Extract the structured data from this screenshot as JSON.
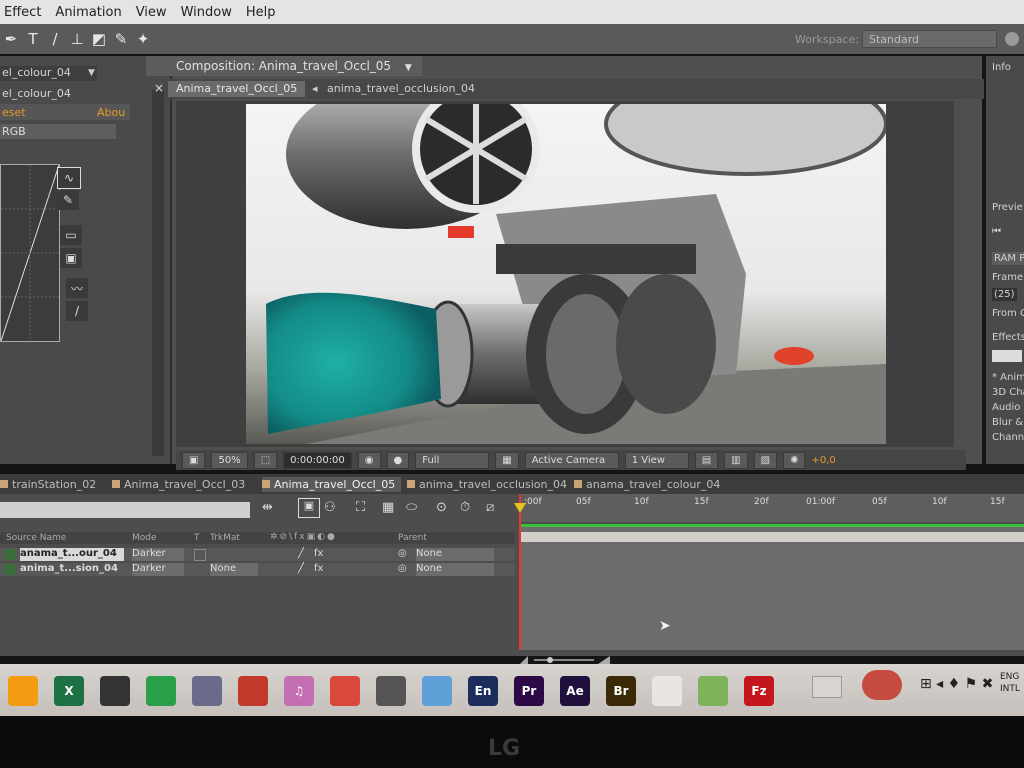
{
  "menu": [
    "Effect",
    "Animation",
    "View",
    "Window",
    "Help"
  ],
  "workspace": {
    "label": "Workspace:",
    "value": "Standard"
  },
  "left_panel": {
    "tab": "el_colour_04",
    "layer_label": "el_colour_04",
    "reset": "eset",
    "about": "Abou",
    "channel": "RGB"
  },
  "composition": {
    "tab_label": "Composition: Anima_travel_Occl_05",
    "nav_current": "Anima_travel_Occl_05",
    "nav_parent": "anima_travel_occlusion_04"
  },
  "viewer_bar": {
    "zoom": "50%",
    "timecode": "0:00:00:00",
    "resolution": "Full",
    "camera": "Active Camera",
    "views": "1 View",
    "exposure": "+0,0"
  },
  "right_panel": {
    "info": "Info",
    "preview": "Previe",
    "ram_preview": "RAM Pr",
    "frame_rate": "Frame Ra",
    "fps": "(25)",
    "from": "From C",
    "effects": "Effects & P",
    "items": [
      "* Animatio",
      "3D Channe",
      "Audio",
      "Blur & Shar",
      "Channel"
    ]
  },
  "timeline_tabs": [
    "trainStation_02",
    "Anima_travel_Occl_03",
    "Anima_travel_Occl_05",
    "anima_travel_occlusion_04",
    "anama_travel_colour_04"
  ],
  "layer_header": {
    "source_name": "Source Name",
    "mode": "Mode",
    "t": "T",
    "trkmat": "TrkMat",
    "parent": "Parent"
  },
  "layers": [
    {
      "name": "anama_t...our_04",
      "mode": "Darker",
      "trkmat": "",
      "parent": "None"
    },
    {
      "name": "anima_t...sion_04",
      "mode": "Darker",
      "trkmat": "None",
      "parent": "None"
    }
  ],
  "ruler_ticks": [
    ":00f",
    "05f",
    "10f",
    "15f",
    "20f",
    "01:00f",
    "05f",
    "10f",
    "15f"
  ],
  "taskbar_apps": [
    {
      "name": "VLC",
      "label": "",
      "color": "#f39c12"
    },
    {
      "name": "Excel",
      "label": "X",
      "color": "#1e7145"
    },
    {
      "name": "Unity",
      "label": "",
      "color": "#333333"
    },
    {
      "name": "Chrome-like",
      "label": "",
      "color": "#2aa04a"
    },
    {
      "name": "Cinema4D",
      "label": "",
      "color": "#6a6a8a"
    },
    {
      "name": "Game",
      "label": "",
      "color": "#c0392b"
    },
    {
      "name": "iTunes",
      "label": "♫",
      "color": "#c56fb3"
    },
    {
      "name": "FileZilla-red",
      "label": "",
      "color": "#d9483b"
    },
    {
      "name": "Ghost",
      "label": "",
      "color": "#555555"
    },
    {
      "name": "Notes",
      "label": "",
      "color": "#5fa0d8"
    },
    {
      "name": "Encore",
      "label": "En",
      "color": "#1c2c5c"
    },
    {
      "name": "Premiere",
      "label": "Pr",
      "color": "#2d0a45"
    },
    {
      "name": "After Effects",
      "label": "Ae",
      "color": "#1e0f3c"
    },
    {
      "name": "Bridge",
      "label": "Br",
      "color": "#3b2a08"
    },
    {
      "name": "Acrobat",
      "label": "",
      "color": "#e9e6e2"
    },
    {
      "name": "Photos",
      "label": "",
      "color": "#7fb35a"
    },
    {
      "name": "FileZilla",
      "label": "Fz",
      "color": "#c4161c"
    }
  ],
  "tray": {
    "lang": "ENG",
    "lang2": "INTL"
  },
  "monitor_brand": "LG"
}
